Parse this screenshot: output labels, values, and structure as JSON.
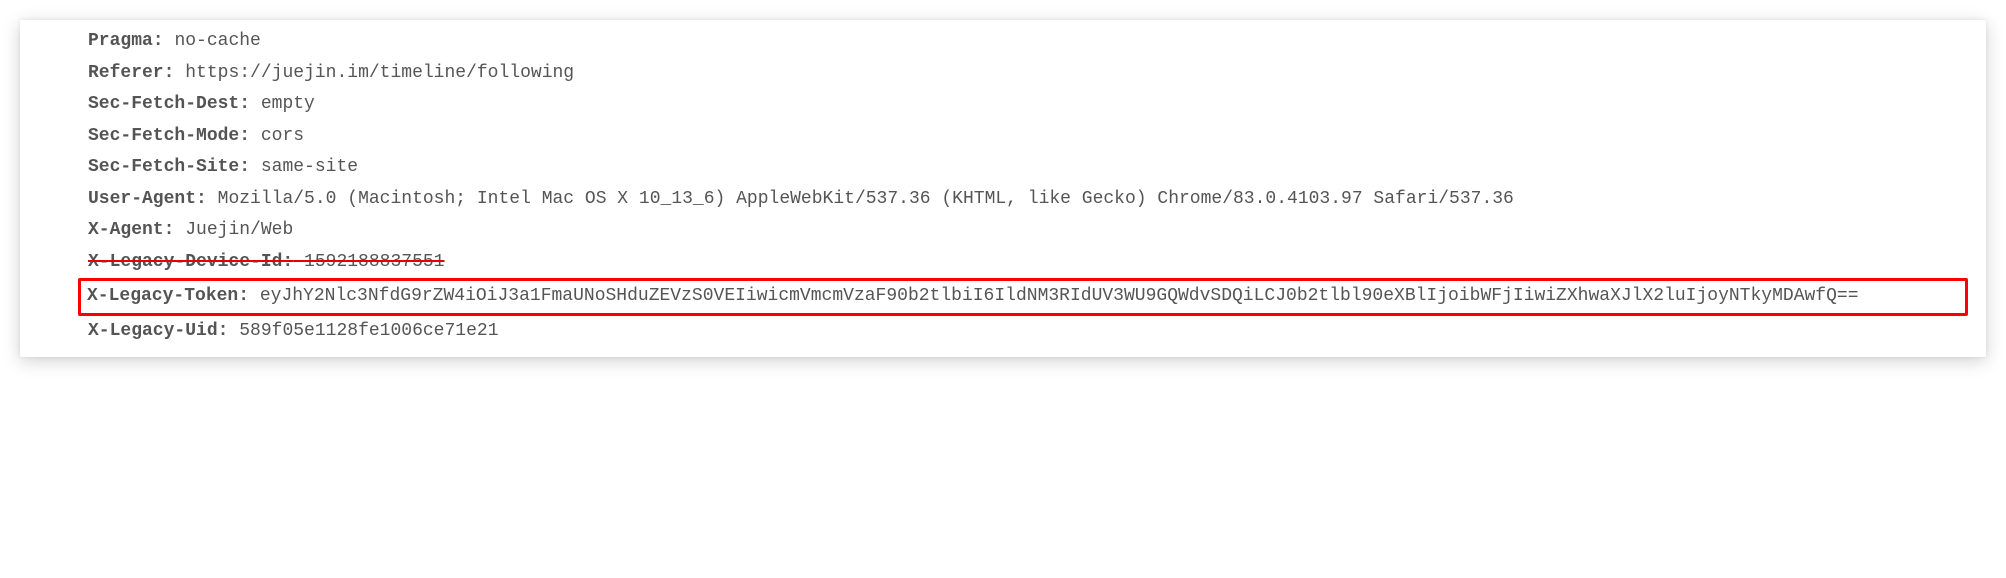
{
  "headers": {
    "pragma": {
      "key": "Pragma:",
      "value": "no-cache"
    },
    "referer": {
      "key": "Referer:",
      "value": "https://juejin.im/timeline/following"
    },
    "secFetchDest": {
      "key": "Sec-Fetch-Dest:",
      "value": "empty"
    },
    "secFetchMode": {
      "key": "Sec-Fetch-Mode:",
      "value": "cors"
    },
    "secFetchSite": {
      "key": "Sec-Fetch-Site:",
      "value": "same-site"
    },
    "userAgent": {
      "key": "User-Agent:",
      "value": "Mozilla/5.0 (Macintosh; Intel Mac OS X 10_13_6) AppleWebKit/537.36 (KHTML, like Gecko) Chrome/83.0.4103.97 Safari/537.36"
    },
    "xAgent": {
      "key": "X-Agent:",
      "value": "Juejin/Web"
    },
    "xLegacyDeviceId": {
      "key": "X-Legacy-Device-Id:",
      "value": "1592188837551"
    },
    "xLegacyToken": {
      "key": "X-Legacy-Token:",
      "value": "eyJhY2Nlc3NfdG9rZW4iOiJ3a1FmaUNoSHduZEVzS0VEIiwicmVmcmVzaF90b2tlbiI6IldNM3RIdUV3WU9GQWdvSDQiLCJ0b2tlbl90eXBlIjoibWFjIiwiZXhwaXJlX2luIjoyNTkyMDAwfQ=="
    },
    "xLegacyUid": {
      "key": "X-Legacy-Uid:",
      "value": "589f05e1128fe1006ce71e21"
    }
  }
}
